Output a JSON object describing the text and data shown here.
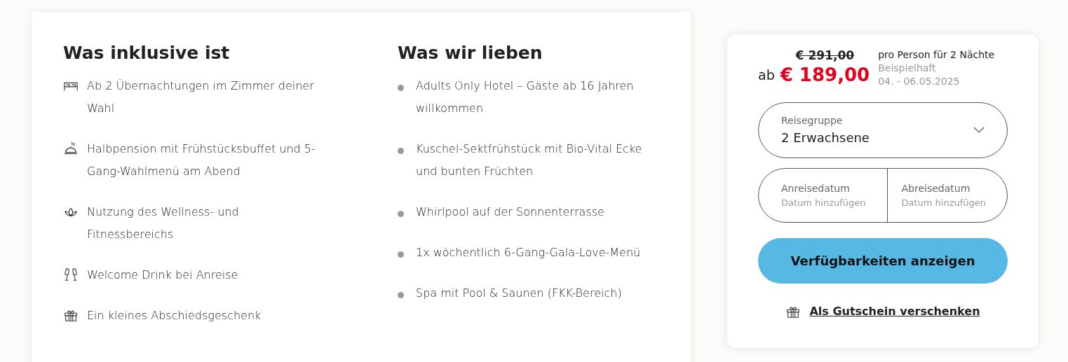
{
  "inclusive": {
    "title": "Was inklusive ist",
    "items": [
      {
        "kind": "bed",
        "text": "Ab 2 Übernachtungen im Zimmer deiner Wahl"
      },
      {
        "kind": "dining",
        "text": "Halbpension mit Frühstücksbuffet und 5-Gang-Wahlmenü am Abend"
      },
      {
        "kind": "lotus",
        "text": "Nutzung des Wellness- und Fitnessbereichs"
      },
      {
        "kind": "glasses",
        "text": "Welcome Drink bei Anreise"
      },
      {
        "kind": "gift",
        "text": "Ein kleines Abschiedsgeschenk"
      }
    ]
  },
  "loves": {
    "title": "Was wir lieben",
    "items": [
      "Adults Only Hotel – Gäste ab 16 Jahren willkommen",
      "Kuschel-Sektfrühstück mit Bio-Vital Ecke und bunten Früchten",
      "Whirlpool auf der Sonnenterrasse",
      "1x wöchentlich 6-Gang-Gala-Love-Menü",
      "Spa mit Pool & Saunen (FKK-Bereich)"
    ]
  },
  "booking": {
    "old_price": "€ 291,00",
    "prefix": "ab",
    "price": "€ 189,00",
    "per": "pro Person für 2 Nächte",
    "example": "Beispielhaft",
    "dates": "04. - 06.05.2025",
    "group": {
      "label": "Reisegruppe",
      "value": "2 Erwachsene"
    },
    "arrival": {
      "label": "Anreisedatum",
      "placeholder": "Datum hinzufügen"
    },
    "departure": {
      "label": "Abreisedatum",
      "placeholder": "Datum hinzufügen"
    },
    "button": "Verfügbarkeiten anzeigen",
    "voucher": "Als Gutschein verschenken"
  }
}
